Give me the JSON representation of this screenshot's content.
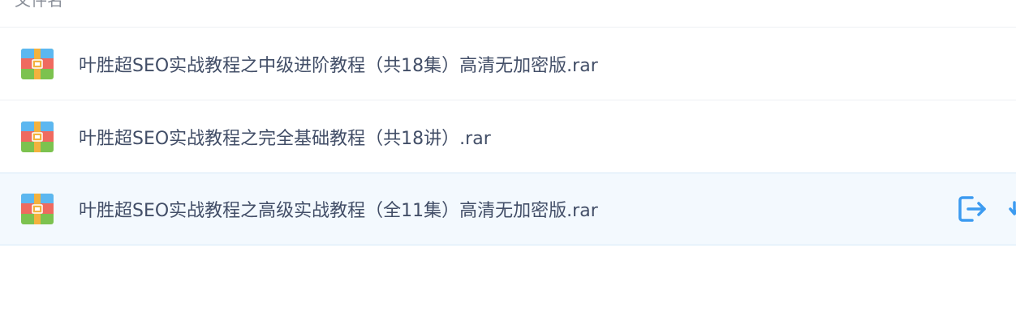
{
  "header": {
    "filename_column": "文件名"
  },
  "files": [
    {
      "name": "叶胜超SEO实战教程之中级进阶教程（共18集）高清无加密版.rar",
      "icon": "rar-archive-icon"
    },
    {
      "name": "叶胜超SEO实战教程之完全基础教程（共18讲）.rar",
      "icon": "rar-archive-icon"
    },
    {
      "name": "叶胜超SEO实战教程之高级实战教程（全11集）高清无加密版.rar",
      "icon": "rar-archive-icon"
    }
  ],
  "colors": {
    "accent": "#3c9bf0",
    "selected_row_bg": "#f3f9fe",
    "text": "#424e67"
  }
}
